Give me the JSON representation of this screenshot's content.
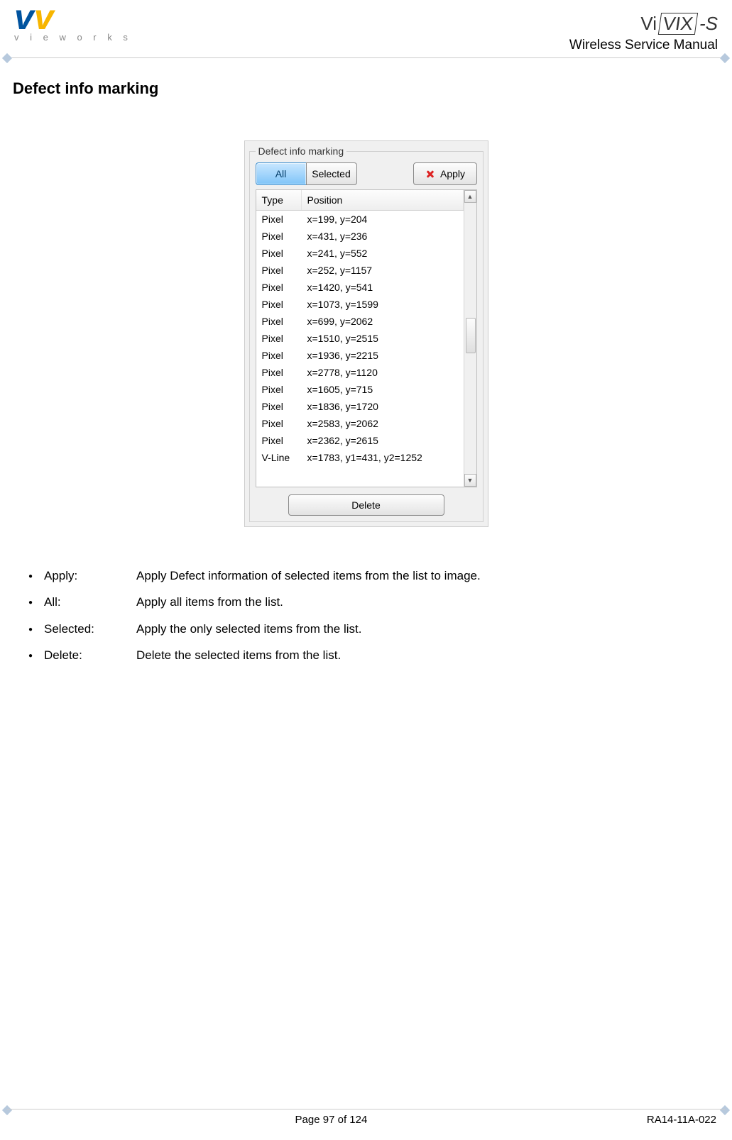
{
  "header": {
    "logo_sub": "v i e w o r k s",
    "vivix_pre": "Vi",
    "vivix_box": "VIX",
    "vivix_suf": "-S",
    "doc_title": "Wireless Service Manual"
  },
  "section_title": "Defect info marking",
  "dialog": {
    "legend": "Defect info marking",
    "tabs": {
      "all": "All",
      "selected": "Selected"
    },
    "apply_label": "Apply",
    "columns": {
      "type": "Type",
      "position": "Position"
    },
    "rows": [
      {
        "type": "Pixel",
        "position": "x=199, y=204"
      },
      {
        "type": "Pixel",
        "position": "x=431, y=236"
      },
      {
        "type": "Pixel",
        "position": "x=241, y=552"
      },
      {
        "type": "Pixel",
        "position": "x=252, y=1157"
      },
      {
        "type": "Pixel",
        "position": "x=1420, y=541"
      },
      {
        "type": "Pixel",
        "position": "x=1073, y=1599"
      },
      {
        "type": "Pixel",
        "position": "x=699, y=2062"
      },
      {
        "type": "Pixel",
        "position": "x=1510, y=2515"
      },
      {
        "type": "Pixel",
        "position": "x=1936, y=2215"
      },
      {
        "type": "Pixel",
        "position": "x=2778, y=1120"
      },
      {
        "type": "Pixel",
        "position": "x=1605, y=715"
      },
      {
        "type": "Pixel",
        "position": "x=1836, y=1720"
      },
      {
        "type": "Pixel",
        "position": "x=2583, y=2062"
      },
      {
        "type": "Pixel",
        "position": "x=2362, y=2615"
      },
      {
        "type": "V-Line",
        "position": "x=1783, y1=431, y2=1252"
      }
    ],
    "delete_label": "Delete"
  },
  "descriptions": [
    {
      "term": "Apply:",
      "def": "Apply Defect information of selected items from the list to image."
    },
    {
      "term": "All:",
      "def": "Apply all items from the list."
    },
    {
      "term": "Selected:",
      "def": "Apply the only selected items from the list."
    },
    {
      "term": "Delete:",
      "def": "Delete the selected items from the list."
    }
  ],
  "footer": {
    "page": "Page 97 of 124",
    "doc_id": "RA14-11A-022"
  }
}
